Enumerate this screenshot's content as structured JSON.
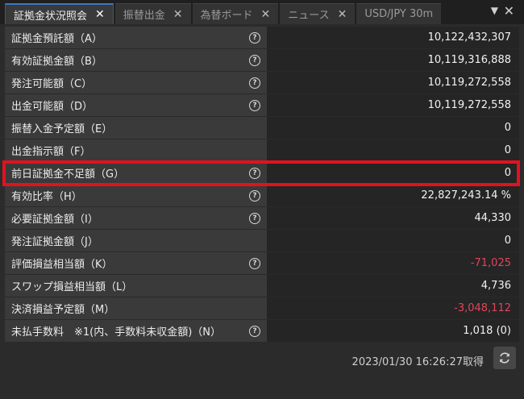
{
  "tabs": [
    {
      "label": "証拠金状況照会",
      "active": true
    },
    {
      "label": "振替出金",
      "active": false
    },
    {
      "label": "為替ボード",
      "active": false
    },
    {
      "label": "ニュース",
      "active": false
    },
    {
      "label": "USD/JPY 30m",
      "active": false
    }
  ],
  "window_controls": {
    "menu_icon": "caret-down-icon",
    "close_icon": "close-icon"
  },
  "rows": [
    {
      "label": "証拠金預託額（A）",
      "value": "10,122,432,307",
      "help": true,
      "negative": false
    },
    {
      "label": "有効証拠金額（B）",
      "value": "10,119,316,888",
      "help": true,
      "negative": false
    },
    {
      "label": "発注可能額（C）",
      "value": "10,119,272,558",
      "help": true,
      "negative": false
    },
    {
      "label": "出金可能額（D）",
      "value": "10,119,272,558",
      "help": true,
      "negative": false
    },
    {
      "label": "振替入金予定額（E）",
      "value": "0",
      "help": false,
      "negative": false
    },
    {
      "label": "出金指示額（F）",
      "value": "0",
      "help": false,
      "negative": false
    },
    {
      "label": "前日証拠金不足額（G）",
      "value": "0",
      "help": true,
      "negative": false
    },
    {
      "label": "有効比率（H）",
      "value": "22,827,243.14 %",
      "help": true,
      "negative": false
    },
    {
      "label": "必要証拠金額（I）",
      "value": "44,330",
      "help": true,
      "negative": false
    },
    {
      "label": "発注証拠金額（J）",
      "value": "0",
      "help": false,
      "negative": false
    },
    {
      "label": "評価損益相当額（K）",
      "value": "-71,025",
      "help": true,
      "negative": true
    },
    {
      "label": "スワップ損益相当額（L）",
      "value": "4,736",
      "help": false,
      "negative": false
    },
    {
      "label": "決済損益予定額（M）",
      "value": "-3,048,112",
      "help": false,
      "negative": true
    },
    {
      "label": "未払手数料　※1(内、手数料未収金額)（N）",
      "value": "1,018 (0)",
      "help": true,
      "negative": false
    }
  ],
  "footer": {
    "timestamp": "2023/01/30 16:26:27取得",
    "refresh_icon": "refresh-icon"
  },
  "colors": {
    "highlight": "#e3111f",
    "negative": "#e0455a",
    "accent": "#3b78c4"
  }
}
